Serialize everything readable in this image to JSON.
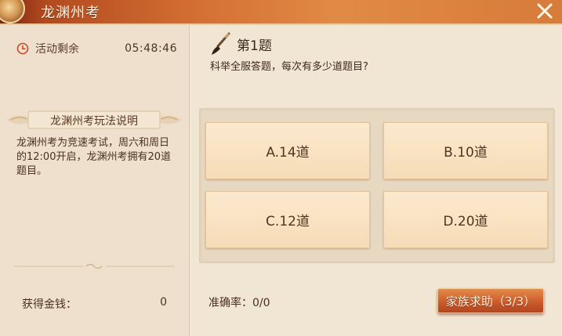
{
  "window": {
    "title": "龙渊州考"
  },
  "sidebar": {
    "timer_label": "活动剩余",
    "timer_value": "05:48:46",
    "rules_title": "龙渊州考玩法说明",
    "rules_text": "龙渊州考为竞速考试，周六和周日的12:00开启，龙渊州考拥有20道题目。",
    "money_label": "获得金钱：",
    "money_value": "0"
  },
  "question": {
    "number": "第1题",
    "text": "科举全服答题，每次有多少道题目?",
    "options": [
      "A.14道",
      "B.10道",
      "C.12道",
      "D.20道"
    ]
  },
  "footer": {
    "accuracy": "准确率：0/0",
    "help_button": "家族求助（3/3）"
  },
  "icons": {
    "clock": "clock-icon",
    "brush": "brush-icon",
    "close": "close-icon",
    "emblem": "emblem-icon"
  },
  "colors": {
    "title_bar": "#d46f33",
    "accent_button": "#c9582a",
    "option_bg": "#f6dcb7"
  }
}
